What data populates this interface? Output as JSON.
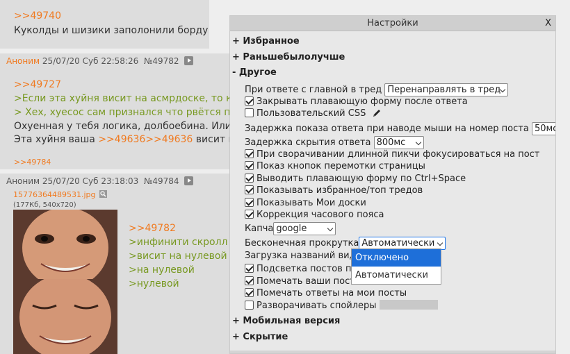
{
  "posts": [
    {
      "reply_link": ">>49740",
      "text": "Куколды и шизики заполонили борду"
    },
    {
      "name": "Аноним",
      "date": "25/07/20 Суб 22:58:26",
      "number": "№49782",
      "reply_link": ">>49727",
      "quote1": ">Если эта хуйня висит на асмрдоске, то кас",
      "quote2": "> Хех, хуесос сам признался что рвётся по н",
      "text1": "Охуенная у тебя логика, долбоебина. Или у",
      "text2_prefix": "Эта хуйня ваша ",
      "text2_link": ">>49636>>49636",
      "text2_suffix": " висит на ну",
      "backlink": ">>49784"
    },
    {
      "name": "Аноним",
      "date": "25/07/20 Суб 23:18:03",
      "number": "№49784",
      "file_name": "15776364489531.jpg",
      "file_info": "(177Кб, 540x720)",
      "reply_link": ">>49782",
      "lines": [
        ">инфинити скролл",
        ">висит на нулевой",
        ">на нулевой",
        ">нулевой"
      ]
    }
  ],
  "settings": {
    "title": "Настройки",
    "close_label": "X",
    "sections": {
      "favorites": "+ Избранное",
      "before": "+ Раньшебылолучше",
      "other": "- Другое",
      "mobile": "+ Мобильная версия",
      "hide": "+ Скрытие"
    },
    "options": {
      "reply_main": "При ответе с главной в тред",
      "reply_main_value": "Перенаправлять в тред",
      "close_form": "Закрывать плавающую форму после ответа",
      "custom_css": "Пользовательский CSS",
      "hover_delay": "Задержка показа ответа при наводе мыши на номер поста",
      "hover_delay_value": "50мс",
      "hide_delay": "Задержка скрытия ответа",
      "hide_delay_value": "800мс",
      "collapse_focus": "При сворачивании длинной пикчи фокусироваться на пост",
      "scroll_buttons": "Показ кнопок перемотки страницы",
      "ctrl_space": "Выводить плавающую форму по Ctrl+Space",
      "show_favorites": "Показывать избранное/топ тредов",
      "my_boards": "Показывать Мои доски",
      "timezone": "Коррекция часового пояса",
      "captcha": "Капча",
      "captcha_value": "google",
      "infinite_scroll": "Бесконечная прокрутка",
      "infinite_scroll_value": "Автоматически",
      "load_video": "Загрузка названий виде",
      "highlight_posts": "Подсветка постов по",
      "mark_posts": "Помечать ваши посты",
      "mark_replies": "Помечать ответы на мои посты",
      "expand_spoilers": "Разворачивать спойлеры"
    },
    "dropdown_options": [
      "Отключено",
      "Автоматически"
    ]
  }
}
